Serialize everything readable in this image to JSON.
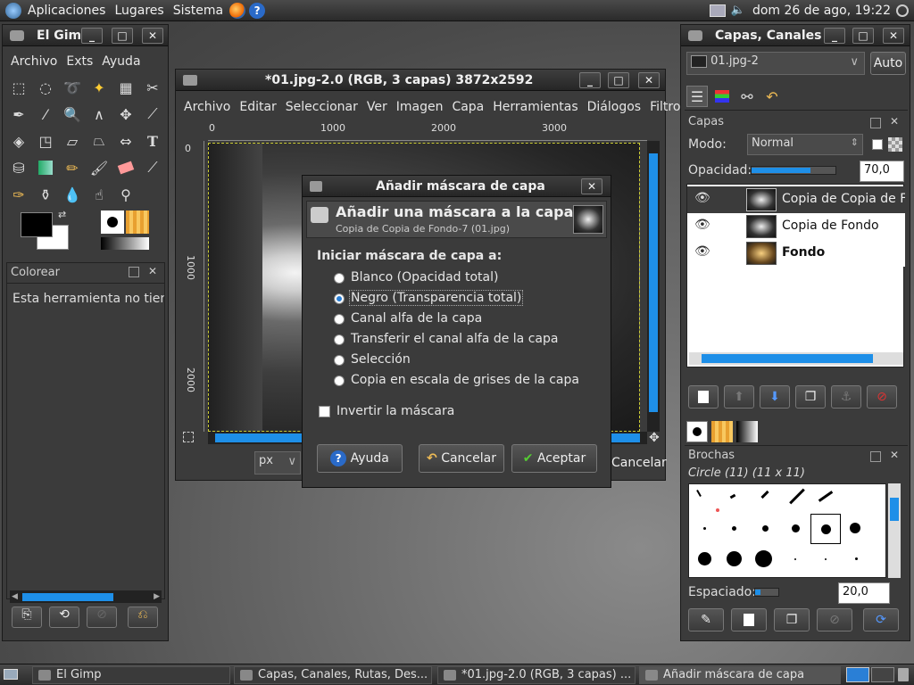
{
  "top_panel": {
    "menus": [
      "Aplicaciones",
      "Lugares",
      "Sistema"
    ],
    "clock": "dom 26 de ago, 19:22"
  },
  "toolbox": {
    "title": "El Gimp",
    "menus": [
      "Archivo",
      "Exts",
      "Ayuda"
    ],
    "tool_options_title": "Colorear",
    "tool_options_text": "Esta herramienta no tiene"
  },
  "image_window": {
    "title": "*01.jpg-2.0 (RGB, 3 capas) 3872x2592",
    "menus": [
      "Archivo",
      "Editar",
      "Seleccionar",
      "Ver",
      "Imagen",
      "Capa",
      "Herramientas",
      "Diálogos",
      "Filtros"
    ],
    "ruler_h": [
      "0",
      "1000",
      "2000",
      "3000"
    ],
    "ruler_v": [
      "0",
      "1000",
      "2000"
    ],
    "unit": "px",
    "cancel_label": "Cancelar"
  },
  "dialog": {
    "title": "Añadir máscara de capa",
    "header": "Añadir una máscara a la capa",
    "subheader": "Copia de Copia de Fondo-7 (01.jpg)",
    "section_label": "Iniciar máscara de capa a:",
    "options": [
      {
        "label": "Blanco (Opacidad total)",
        "selected": false
      },
      {
        "label": "Negro (Transparencia total)",
        "selected": true
      },
      {
        "label": "Canal alfa de la capa",
        "selected": false
      },
      {
        "label": "Transferir el canal alfa de la capa",
        "selected": false
      },
      {
        "label": "Selección",
        "selected": false
      },
      {
        "label": "Copia en escala de grises de la capa",
        "selected": false
      }
    ],
    "invert_label": "Invertir la máscara",
    "help_label": "Ayuda",
    "cancel_label": "Cancelar",
    "ok_label": "Aceptar"
  },
  "layers_window": {
    "title": "Capas, Canales",
    "image_select": "01.jpg-2",
    "auto_label": "Auto",
    "panel_title": "Capas",
    "mode_label": "Modo:",
    "mode_value": "Normal",
    "opacity_label": "Opacidad:",
    "opacity_value": "70,0",
    "opacity_fraction": 0.7,
    "layers": [
      {
        "name": "Copia de Copia de Fo",
        "bold": false,
        "selected": false
      },
      {
        "name": "Copia de Fondo",
        "bold": false,
        "selected": false
      },
      {
        "name": "Fondo",
        "bold": true,
        "selected": false
      }
    ],
    "brushes_title": "Brochas",
    "brush_name": "Circle (11) (11 x 11)",
    "spacing_label": "Espaciado:",
    "spacing_value": "20,0"
  },
  "taskbar": {
    "items": [
      "El Gimp",
      "Capas, Canales, Rutas, Des...",
      "*01.jpg-2.0 (RGB, 3 capas) ...",
      "Añadir máscara de capa"
    ]
  }
}
